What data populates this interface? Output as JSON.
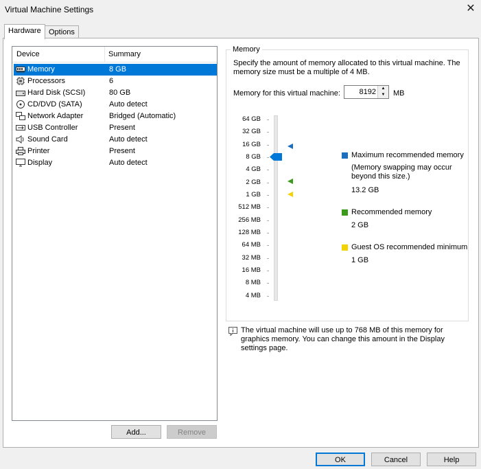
{
  "window": {
    "title": "Virtual Machine Settings",
    "close": "✕"
  },
  "tabs": [
    {
      "label": "Hardware"
    },
    {
      "label": "Options"
    }
  ],
  "devices": {
    "headers": {
      "device": "Device",
      "summary": "Summary"
    },
    "items": [
      {
        "name": "Memory",
        "summary": "8 GB"
      },
      {
        "name": "Processors",
        "summary": "6"
      },
      {
        "name": "Hard Disk (SCSI)",
        "summary": "80 GB"
      },
      {
        "name": "CD/DVD (SATA)",
        "summary": "Auto detect"
      },
      {
        "name": "Network Adapter",
        "summary": "Bridged (Automatic)"
      },
      {
        "name": "USB Controller",
        "summary": "Present"
      },
      {
        "name": "Sound Card",
        "summary": "Auto detect"
      },
      {
        "name": "Printer",
        "summary": "Present"
      },
      {
        "name": "Display",
        "summary": "Auto detect"
      }
    ],
    "selected_index": 0
  },
  "device_buttons": {
    "add": "Add...",
    "remove": "Remove"
  },
  "memory": {
    "group_label": "Memory",
    "description": "Specify the amount of memory allocated to this virtual machine. The memory size must be a multiple of 4 MB.",
    "field_label": "Memory for this virtual machine:",
    "value": "8192",
    "unit": "MB",
    "scale": [
      "64 GB",
      "32 GB",
      "16 GB",
      "8 GB",
      "4 GB",
      "2 GB",
      "1 GB",
      "512 MB",
      "256 MB",
      "128 MB",
      "64 MB",
      "32 MB",
      "16 MB",
      "8 MB",
      "4 MB"
    ],
    "slider_selected": "8 GB",
    "legend": {
      "max": {
        "label": "Maximum recommended memory",
        "note": "(Memory swapping may occur beyond this size.)",
        "value": "13.2 GB",
        "color": "#1a6fbf"
      },
      "recommended": {
        "label": "Recommended memory",
        "value": "2 GB",
        "color": "#3a9a1a"
      },
      "min": {
        "label": "Guest OS recommended minimum",
        "value": "1 GB",
        "color": "#f2d200"
      }
    },
    "graphics_note": "The virtual machine will use up to 768 MB of this memory for graphics memory. You can change this amount in the Display settings page."
  },
  "dialog_buttons": {
    "ok": "OK",
    "cancel": "Cancel",
    "help": "Help"
  }
}
